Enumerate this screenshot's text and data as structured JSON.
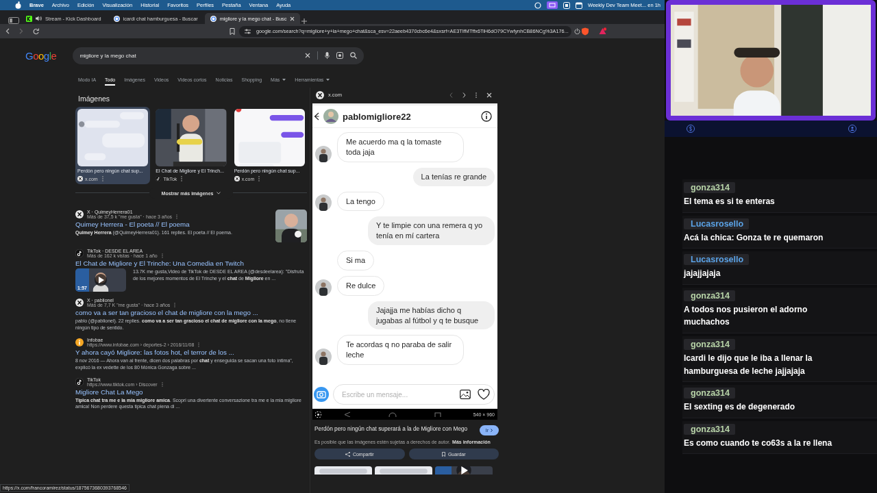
{
  "menubar": {
    "app": "Brave",
    "items": [
      "Archivo",
      "Edición",
      "Visualización",
      "Historial",
      "Favoritos",
      "Perfiles",
      "Pestaña",
      "Ventana",
      "Ayuda"
    ],
    "event": "Weekly Dev Team Meet... en 1h"
  },
  "tabs": [
    {
      "title": "Stream - Kick Dashboard",
      "audio": true,
      "selected": false
    },
    {
      "title": "icardi chat hamburguesa - Buscar",
      "audio": false,
      "selected": false
    },
    {
      "title": "migliore y la mego chat - Busc",
      "audio": false,
      "selected": true
    }
  ],
  "address": "google.com/search?q=migliore+y+la+mego+chat&sca_esv=22aeeb4370cbc6e4&sxsrf=AE3TIfMTffx6TiH6dO79CYwfynhCB86NCg%3A176...",
  "google": {
    "logo": "Google",
    "query": "migliore y la mego chat",
    "nav": [
      {
        "label": "Modo IA",
        "selected": false,
        "dropdown": false
      },
      {
        "label": "Todo",
        "selected": true,
        "dropdown": false
      },
      {
        "label": "Imágenes",
        "selected": false,
        "dropdown": false
      },
      {
        "label": "Videos",
        "selected": false,
        "dropdown": false
      },
      {
        "label": "Videos cortos",
        "selected": false,
        "dropdown": false
      },
      {
        "label": "Noticias",
        "selected": false,
        "dropdown": false
      },
      {
        "label": "Shopping",
        "selected": false,
        "dropdown": false
      },
      {
        "label": "Más",
        "selected": false,
        "dropdown": true
      },
      {
        "label": "Herramientas",
        "selected": false,
        "dropdown": true
      }
    ],
    "images_heading": "Imágenes",
    "images": [
      {
        "title": "Perdón pero ningún chat sup...",
        "source": "x.com",
        "kind": "x",
        "selected": true
      },
      {
        "title": "El Chat de Migliore y El Trinch...",
        "source": "TikTok",
        "kind": "tiktok",
        "selected": false
      },
      {
        "title": "Perdón pero ningún chat sup...",
        "source": "x.com",
        "kind": "x",
        "selected": false
      }
    ],
    "more_images": "Mostrar más imágenes",
    "results": [
      {
        "kind": "x",
        "site": "X · QuimeyHerrera01",
        "meta": "Más de 37,5 k \"me gusta\" · hace 3 años",
        "title": "Quimey Herrera - El poeta // El poema",
        "snippet": "**Quimey Herrera** (@QuimeyHerrera01). 161 replies. El poeta // El poema.",
        "thumbnail": true
      },
      {
        "kind": "tiktok",
        "site": "TikTok · DESDE EL AREA",
        "meta": "Más de 162 k vistas · hace 1 año",
        "title": "El Chat de Migliore y El Trinche: Una Comedia en Twitch",
        "snippet": "13.7K me gusta,Video de TikTok de DESDE EL AREA (@desdeelarea): \"Disfruta de los mejores momentos de El Trinche y el **chat** de **Migliore** en ...",
        "thumbnail": false,
        "duration": "1:57"
      },
      {
        "kind": "x",
        "site": "X · pablionel",
        "meta": "Más de 7,7 K \"me gusta\" · hace 3 años",
        "title": "como va a ser tan gracioso el chat de migliore con la mego ...",
        "snippet": "pablo (@pablionel). 22 replies. **como va a ser tan gracioso el chat de migliore con la mego**, no tiene ningún tipo de sentido.",
        "thumbnail": false
      },
      {
        "kind": "infobae",
        "site": "Infobae",
        "meta": "https://www.infobae.com › deportes-2 › 2016/11/08",
        "title": "Y ahora cayó Migliore: las fotos hot, el terror de los ...",
        "snippet": "8 nov 2016 — Ahora van al frente, dicen dos palabras por **chat** y enseguida se sacan una foto íntima\", explicó la ex vedette de los 80 Mónica Gonzaga sobre ...",
        "thumbnail": false
      },
      {
        "kind": "tiktok",
        "site": "TikTok",
        "meta": "https://www.tiktok.com › Discover",
        "title": "Migliore Chat La Mego",
        "snippet": "**Tipica chat tra me e la mia migliore amica**. Scopri una divertente conversazione tra me e la mia migliore amica! Non perdere questa tipica chat piena di ...",
        "thumbnail": false
      }
    ],
    "status_url": "https://x.com/francoramirez/status/1875673680393768546"
  },
  "preview": {
    "site": "x.com",
    "username": "pablomigliore22",
    "messages": [
      {
        "text": "Me acuerdo ma q la tomaste toda jaja",
        "kind": "in",
        "avatar": true
      },
      {
        "text": "La tenías re grande",
        "kind": "out",
        "avatar": false
      },
      {
        "text": "La tengo",
        "kind": "in",
        "avatar": true
      },
      {
        "text": "Y te limpie con una remera q yo tenía en mí cartera",
        "kind": "out",
        "avatar": false
      },
      {
        "text": "Si ma",
        "kind": "in",
        "avatar": false
      },
      {
        "text": "Re dulce",
        "kind": "in",
        "avatar": true
      },
      {
        "text": "Jajajja me habías dicho q jugabas al fútbol y q te busque",
        "kind": "out",
        "avatar": false
      },
      {
        "text": "Te acordas q no paraba de salir leche",
        "kind": "in",
        "avatar": true
      }
    ],
    "composer_placeholder": "Escribe un mensaje...",
    "size": "540 × 960",
    "caption": "Perdón pero ningún chat superará a la de Migliore con Mego",
    "visit": "Ir",
    "notice": "Es posible que las imágenes estén sujetas a derechos de autor.",
    "notice_link": "Más información",
    "share": "Compartir",
    "save": "Guardar"
  },
  "chat": [
    {
      "user": "gonza314",
      "color": "#b8d4a8",
      "text": "El tema es si te enteras"
    },
    {
      "user": "Lucasrosello",
      "color": "#5aa2e6",
      "text": "Acá la chica: Gonza te re quemaron"
    },
    {
      "user": "Lucasrosello",
      "color": "#5aa2e6",
      "text": "jajajjajaja"
    },
    {
      "user": "gonza314",
      "color": "#b8d4a8",
      "text": "A todos nos pusieron el adorno muchachos"
    },
    {
      "user": "gonza314",
      "color": "#b8d4a8",
      "text": "Icardi le dijo que le iba a llenar la hamburguesa de leche jajjajaja"
    },
    {
      "user": "gonza314",
      "color": "#b8d4a8",
      "text": "El sexting es de degenerado"
    },
    {
      "user": "gonza314",
      "color": "#b8d4a8",
      "text": "Es como cuando te co63s a la re llena"
    }
  ]
}
